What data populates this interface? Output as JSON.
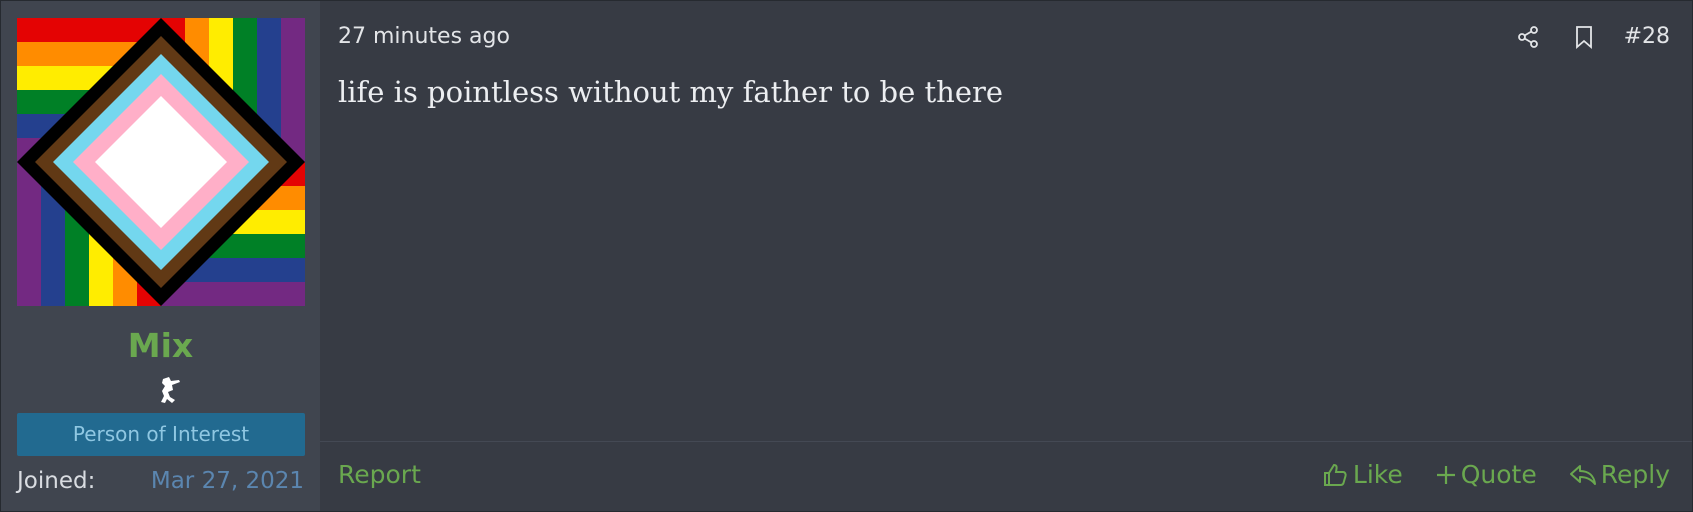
{
  "post": {
    "timestamp": "27 minutes ago",
    "post_number": "#28",
    "message": "life is pointless without my father to be there",
    "report_label": "Report",
    "actions": {
      "like_label": "Like",
      "quote_label": "Quote",
      "reply_label": "Reply"
    },
    "header_icons": [
      "share-icon",
      "bookmark-icon"
    ]
  },
  "user": {
    "username": "Mix",
    "user_title": "Person of Interest",
    "joined_label": "Joined:",
    "joined_value": "Mar 27, 2021",
    "avatar_icon": "pride-flag-pinwheel-avatar",
    "badge_icon": "user-badge-icon"
  },
  "colors": {
    "accent_green": "#6aa84f",
    "user_title_bg": "#226a90",
    "user_title_text": "#8fc7e2",
    "joined_value": "#5b86b0",
    "post_bg": "#373b44",
    "user_col_bg": "#40454f"
  }
}
